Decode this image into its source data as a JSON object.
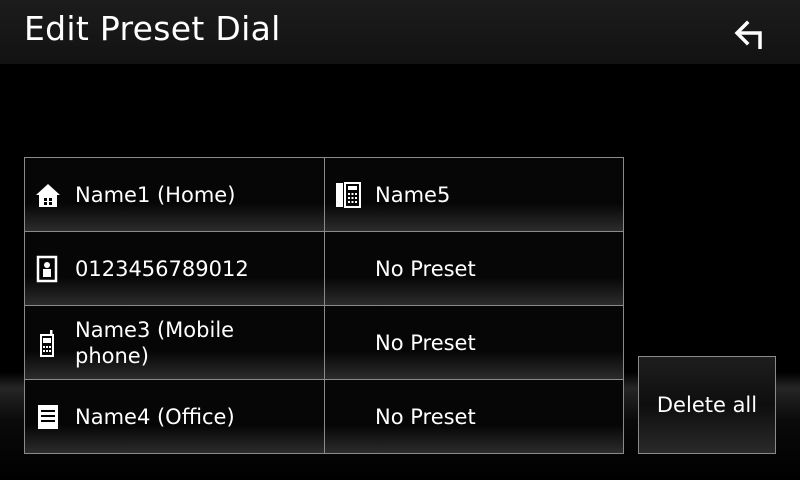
{
  "header": {
    "title": "Edit Preset Dial"
  },
  "presets": {
    "p1": {
      "label": "Name1 (Home)",
      "icon": "home-icon"
    },
    "p2": {
      "label": "0123456789012",
      "icon": "contact-icon"
    },
    "p3": {
      "label_line1": "Name3 (Mobile",
      "label_line2": "phone)",
      "icon": "mobile-phone-icon"
    },
    "p4": {
      "label": "Name4 (Office)",
      "icon": "office-icon"
    },
    "p5": {
      "label": "Name5",
      "icon": "phonebook-icon"
    },
    "p6": {
      "label": "No Preset"
    },
    "p7": {
      "label": "No Preset"
    },
    "p8": {
      "label": "No Preset"
    }
  },
  "actions": {
    "delete_all_label": "Delete all",
    "back_icon": "back-arrow-icon"
  },
  "colors": {
    "background": "#000000",
    "text": "#ffffff",
    "cell_border": "#8a8a8a"
  }
}
